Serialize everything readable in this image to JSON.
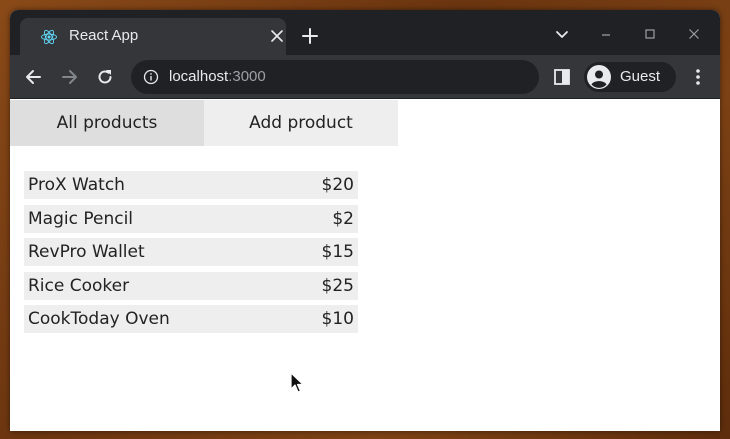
{
  "browser": {
    "tab_title": "React App",
    "url_host": "localhost",
    "url_port": ":3000",
    "profile_name": "Guest"
  },
  "app": {
    "nav": [
      {
        "label": "All products",
        "active": true
      },
      {
        "label": "Add product",
        "active": false
      }
    ],
    "products": [
      {
        "name": "ProX Watch",
        "price": "$20"
      },
      {
        "name": "Magic Pencil",
        "price": "$2"
      },
      {
        "name": "RevPro Wallet",
        "price": "$15"
      },
      {
        "name": "Rice Cooker",
        "price": "$25"
      },
      {
        "name": "CookToday Oven",
        "price": "$10"
      }
    ]
  },
  "colors": {
    "chrome_dark": "#202124",
    "chrome_tab": "#35363a",
    "nav_active": "#dedede",
    "nav_inactive": "#eeeeee",
    "row_bg": "#eeeeee",
    "react_blue": "#61dafb"
  },
  "icons": [
    "react-icon",
    "close-icon",
    "plus-icon",
    "chevron-down-icon",
    "minimize-icon",
    "maximize-icon",
    "back-arrow-icon",
    "forward-arrow-icon",
    "reload-icon",
    "info-icon",
    "side-panel-icon",
    "avatar-icon",
    "kebab-menu-icon",
    "cursor-icon"
  ]
}
